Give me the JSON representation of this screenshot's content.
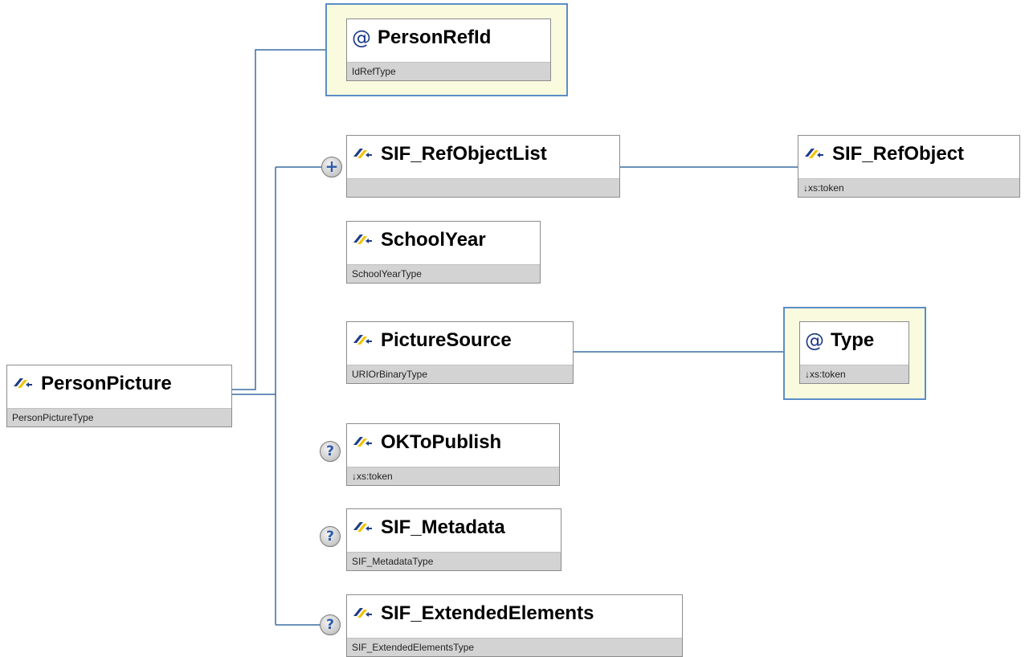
{
  "root": {
    "name": "PersonPicture",
    "type": "PersonPictureType",
    "icon": "element-icon"
  },
  "attributes": {
    "person_ref_id": {
      "name": "PersonRefId",
      "type": "IdRefType",
      "icon": "attribute-at-icon",
      "symbol": "@"
    },
    "type": {
      "name": "Type",
      "type": "↓xs:token",
      "icon": "attribute-at-icon",
      "symbol": "@"
    }
  },
  "elements": {
    "sif_ref_object_list": {
      "name": "SIF_RefObjectList",
      "type": "",
      "badge": "+",
      "badge_icon": "expand-plus-icon"
    },
    "sif_ref_object": {
      "name": "SIF_RefObject",
      "type": "↓xs:token"
    },
    "school_year": {
      "name": "SchoolYear",
      "type": "SchoolYearType"
    },
    "picture_source": {
      "name": "PictureSource",
      "type": "URIOrBinaryType"
    },
    "ok_to_publish": {
      "name": "OKToPublish",
      "type": "↓xs:token",
      "badge": "?",
      "badge_icon": "optional-question-icon"
    },
    "sif_metadata": {
      "name": "SIF_Metadata",
      "type": "SIF_MetadataType",
      "badge": "?",
      "badge_icon": "optional-question-icon"
    },
    "sif_extended_elements": {
      "name": "SIF_ExtendedElements",
      "type": "SIF_ExtendedElementsType",
      "badge": "?",
      "badge_icon": "optional-question-icon"
    }
  },
  "colors": {
    "connector": "#3d6da3",
    "attribute_frame_border": "#5a8ec6",
    "attribute_frame_fill": "#fafadf",
    "type_band": "#d3d3d3",
    "icon_blue": "#1f3c88",
    "icon_yellow": "#f2c200"
  }
}
